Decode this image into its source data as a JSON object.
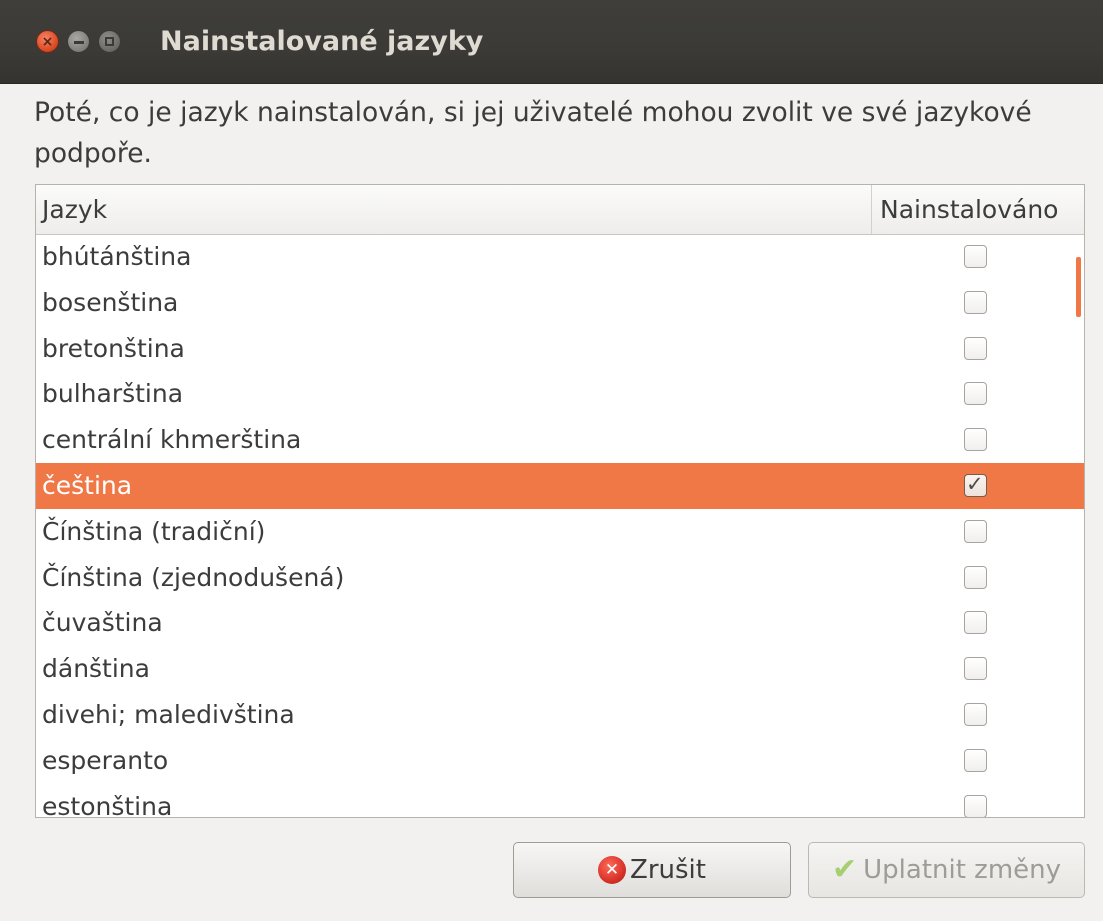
{
  "window": {
    "title": "Nainstalované jazyky",
    "close_glyph": "×"
  },
  "description": "Poté, co je jazyk nainstalován, si jej uživatelé mohou zvolit ve své jazykové podpoře.",
  "list": {
    "columns": {
      "language": "Jazyk",
      "installed": "Nainstalováno"
    },
    "rows": [
      {
        "label": "bhútánština",
        "installed": false
      },
      {
        "label": "bosenština",
        "installed": false
      },
      {
        "label": "bretonština",
        "installed": false
      },
      {
        "label": "bulharština",
        "installed": false
      },
      {
        "label": "centrální khmerština",
        "installed": false
      },
      {
        "label": "čeština",
        "installed": true,
        "selected": true
      },
      {
        "label": "Čínština (tradiční)",
        "installed": false
      },
      {
        "label": "Čínština (zjednodušená)",
        "installed": false
      },
      {
        "label": "čuvaština",
        "installed": false
      },
      {
        "label": "dánština",
        "installed": false
      },
      {
        "label": "divehi; maledivština",
        "installed": false
      },
      {
        "label": "esperanto",
        "installed": false
      },
      {
        "label": "estonština",
        "installed": false
      }
    ]
  },
  "buttons": {
    "cancel": {
      "label": "Zrušit",
      "icon": "cancel-icon",
      "icon_glyph": "✕"
    },
    "apply": {
      "label": "Uplatnit změny",
      "icon": "checkmark-icon",
      "icon_glyph": "✔",
      "enabled": false
    }
  },
  "colors": {
    "selection": "#f07746",
    "titlebar": "#3c3b37"
  }
}
